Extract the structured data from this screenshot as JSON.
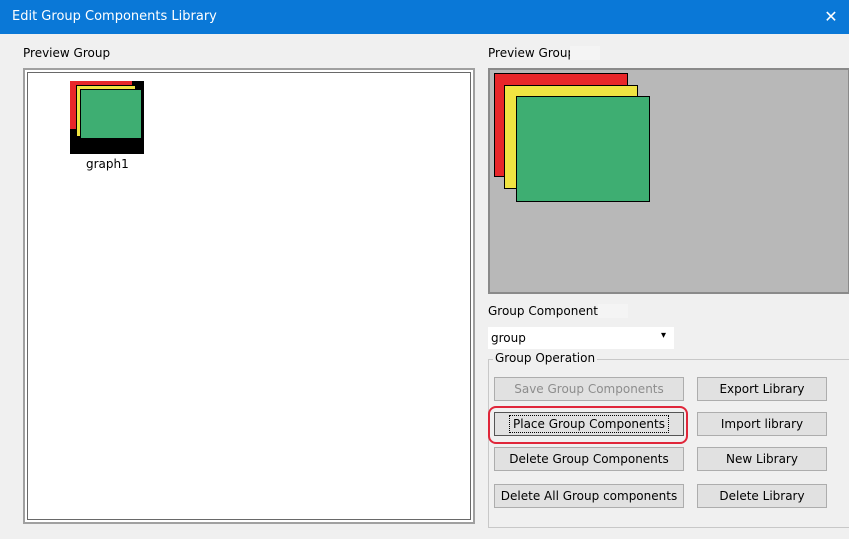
{
  "window": {
    "title": "Edit Group Components Library",
    "close_glyph": "✕"
  },
  "left_panel": {
    "label": "Preview Group",
    "items": [
      {
        "name": "graph1"
      }
    ]
  },
  "right_panel": {
    "label": "Preview Group"
  },
  "group_components": {
    "label": "Group Components",
    "selected": "group",
    "arrow": "▾"
  },
  "group_operation": {
    "legend": "Group Operation",
    "buttons": {
      "save": "Save Group Components",
      "export": "Export Library",
      "place": "Place Group Components",
      "import": "Import library",
      "delete": "Delete Group Components",
      "new": "New Library",
      "delete_all": "Delete All Group components",
      "delete_library": "Delete Library"
    }
  },
  "colors": {
    "titlebar": "#0a78d7",
    "red": "#e8262a",
    "yellow": "#f0e442",
    "green": "#3eae72",
    "highlight": "#e0263a",
    "preview_bg": "#b8b8b8"
  }
}
